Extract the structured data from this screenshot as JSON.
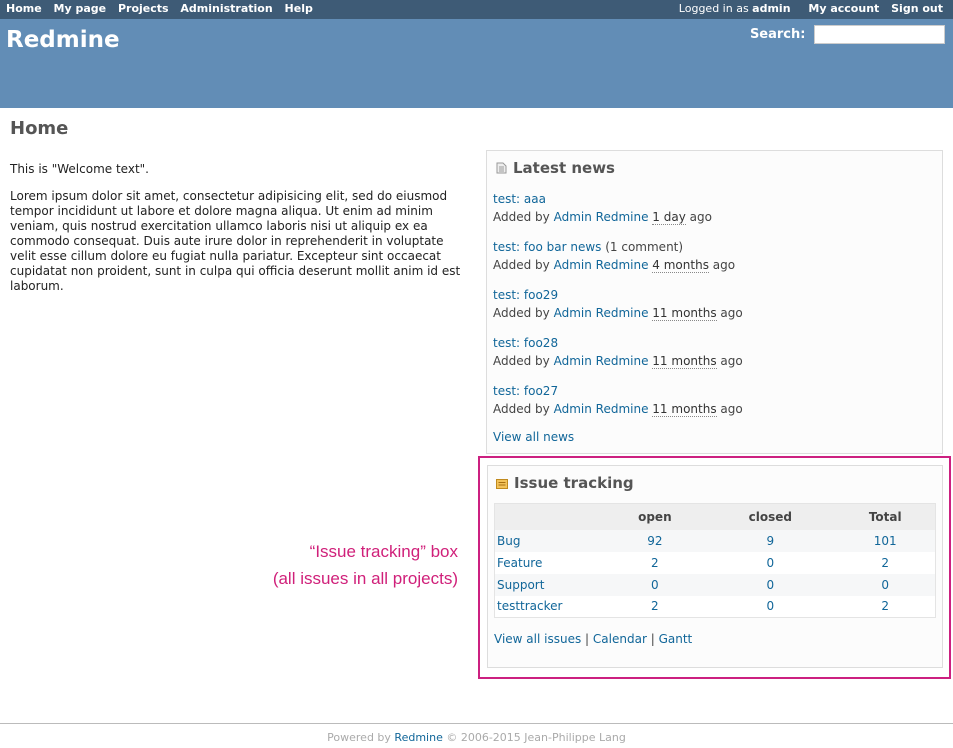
{
  "top_menu": {
    "items": [
      "Home",
      "My page",
      "Projects",
      "Administration",
      "Help"
    ],
    "logged_in_prefix": "Logged in as",
    "user": "admin",
    "my_account": "My account",
    "sign_out": "Sign out"
  },
  "header": {
    "title": "Redmine",
    "search_label": "Search:",
    "search_value": ""
  },
  "page_title": "Home",
  "welcome": {
    "line1": "This is \"Welcome text\".",
    "lorem": "Lorem ipsum dolor sit amet, consectetur adipisicing elit, sed do eiusmod tempor incididunt ut labore et dolore magna aliqua. Ut enim ad minim veniam, quis nostrud exercitation ullamco laboris nisi ut aliquip ex ea commodo consequat. Duis aute irure dolor in reprehenderit in voluptate velit esse cillum dolore eu fugiat nulla pariatur. Excepteur sint occaecat cupidatat non proident, sunt in culpa qui officia deserunt mollit anim id est laborum."
  },
  "news": {
    "title": "Latest news",
    "added_by": "Added by",
    "ago": "ago",
    "items": [
      {
        "title": "test: aaa",
        "comments": "",
        "author": "Admin Redmine",
        "time": "1 day"
      },
      {
        "title": "test: foo bar news",
        "comments": "(1 comment)",
        "author": "Admin Redmine",
        "time": "4 months"
      },
      {
        "title": "test: foo29",
        "comments": "",
        "author": "Admin Redmine",
        "time": "11 months"
      },
      {
        "title": "test: foo28",
        "comments": "",
        "author": "Admin Redmine",
        "time": "11 months"
      },
      {
        "title": "test: foo27",
        "comments": "",
        "author": "Admin Redmine",
        "time": "11 months"
      }
    ],
    "view_all": "View all news"
  },
  "issues": {
    "title": "Issue tracking",
    "columns": [
      "",
      "open",
      "closed",
      "Total"
    ],
    "rows": [
      {
        "tracker": "Bug",
        "open": "92",
        "closed": "9",
        "total": "101"
      },
      {
        "tracker": "Feature",
        "open": "2",
        "closed": "0",
        "total": "2"
      },
      {
        "tracker": "Support",
        "open": "0",
        "closed": "0",
        "total": "0"
      },
      {
        "tracker": "testtracker",
        "open": "2",
        "closed": "0",
        "total": "2"
      }
    ],
    "links": [
      "View all issues",
      "Calendar",
      "Gantt"
    ],
    "separator": "|"
  },
  "annotation": {
    "line1": "“Issue tracking” box",
    "line2": "(all issues in all projects)"
  },
  "footer": {
    "prefix": "Powered by",
    "link": "Redmine",
    "suffix": "© 2006-2015 Jean-Philippe Lang"
  },
  "colors": {
    "top_menu_bg": "#3e5b76",
    "header_bg": "#628db6",
    "link": "#116699",
    "highlight": "#cc2080"
  }
}
